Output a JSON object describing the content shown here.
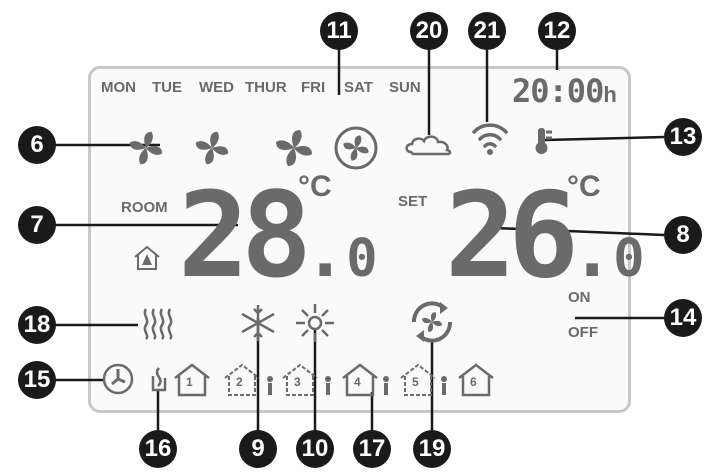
{
  "days": [
    "MON",
    "TUE",
    "WED",
    "THUR",
    "FRI",
    "SAT",
    "SUN"
  ],
  "clock": {
    "time": "20:00",
    "unit": "h"
  },
  "room": {
    "label": "ROOM",
    "value": "28",
    "decimal": "0",
    "unit": "°C"
  },
  "set": {
    "label": "SET",
    "value": "26",
    "decimal": "0",
    "unit": "°C"
  },
  "power": {
    "on": "ON",
    "off": "OFF"
  },
  "callouts": {
    "c6": "6",
    "c7": "7",
    "c8": "8",
    "c9": "9",
    "c10": "10",
    "c11": "11",
    "c12": "12",
    "c13": "13",
    "c14": "14",
    "c15": "15",
    "c16": "16",
    "c17": "17",
    "c18": "18",
    "c19": "19",
    "c20": "20",
    "c21": "21"
  },
  "programs": [
    "1",
    "2",
    "3",
    "4",
    "5",
    "6"
  ],
  "colors": {
    "lcd_segment": "#6a6a6a",
    "callout": "#1a1a1a",
    "frame": "#c8c8c8"
  }
}
